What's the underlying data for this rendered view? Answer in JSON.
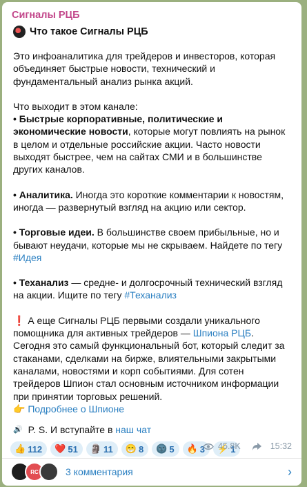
{
  "channel": {
    "name": "Сигналы РЦБ"
  },
  "post": {
    "title": "Что такое Сигналы РЦБ",
    "intro": "Это инфоаналитика для трейдеров и инвесторов, которая объединяет быстрые новости, технический и фундаментальный анализ рынка акций.",
    "section_heading": "Что выходит в этом канале:",
    "item1_bold": "• Быстрые корпоративные, политические и экономические новости",
    "item1_rest": ", которые могут повлиять на рынок в целом и отдельные российские акции. Часто новости выходят быстрее, чем на сайтах СМИ и в большинстве других каналов.",
    "item2_bold": "• Аналитика.",
    "item2_rest": " Иногда это короткие комментарии к новостям, иногда — развернутый взгляд на акцию или сектор.",
    "item3_bold": "• Торговые идеи.",
    "item3_rest": " В большинстве своем прибыльные, но и бывают неудачи, которые мы не скрываем. Найдете по тегу ",
    "item3_tag": "#Идея",
    "item4_bold": "• Теханализ",
    "item4_rest": " — средне- и долгосрочный технический взгляд на акции. Ищите по тегу ",
    "item4_tag": "#Теханализ",
    "spy_icon": "❗",
    "spy_text1": " А еще Сигналы РЦБ первыми создали уникального помощника для активных трейдеров — ",
    "spy_link": "Шпиона РЦБ",
    "spy_text2": ". Сегодня это самый функциональный бот, который следит за стаканами, сделками на бирже, влиятельными закрытыми каналами, новостями и корп событиями. Для сотен трейдеров Шпион стал основным источником информации при принятии торговых решений.",
    "more_icon": "👉",
    "more_link": "Подробнее о Шпионе",
    "ps_icon": "🔊",
    "ps_text": " P. S. И вступайте в ",
    "ps_link": "наш чат"
  },
  "reactions": [
    {
      "emoji": "👍",
      "count": "112"
    },
    {
      "emoji": "❤️",
      "count": "51"
    },
    {
      "emoji": "🗿",
      "count": "11"
    },
    {
      "emoji": "😁",
      "count": "8"
    },
    {
      "emoji": "🌚",
      "count": "5"
    },
    {
      "emoji": "🔥",
      "count": "3"
    },
    {
      "emoji": "⚡",
      "count": "1"
    }
  ],
  "meta": {
    "views_icon": "eye-icon",
    "views": "45.8K",
    "share_icon": "share-arrow-icon",
    "time": "15:32"
  },
  "comments": {
    "label": "3 комментария",
    "avatar2_text": "RC"
  }
}
